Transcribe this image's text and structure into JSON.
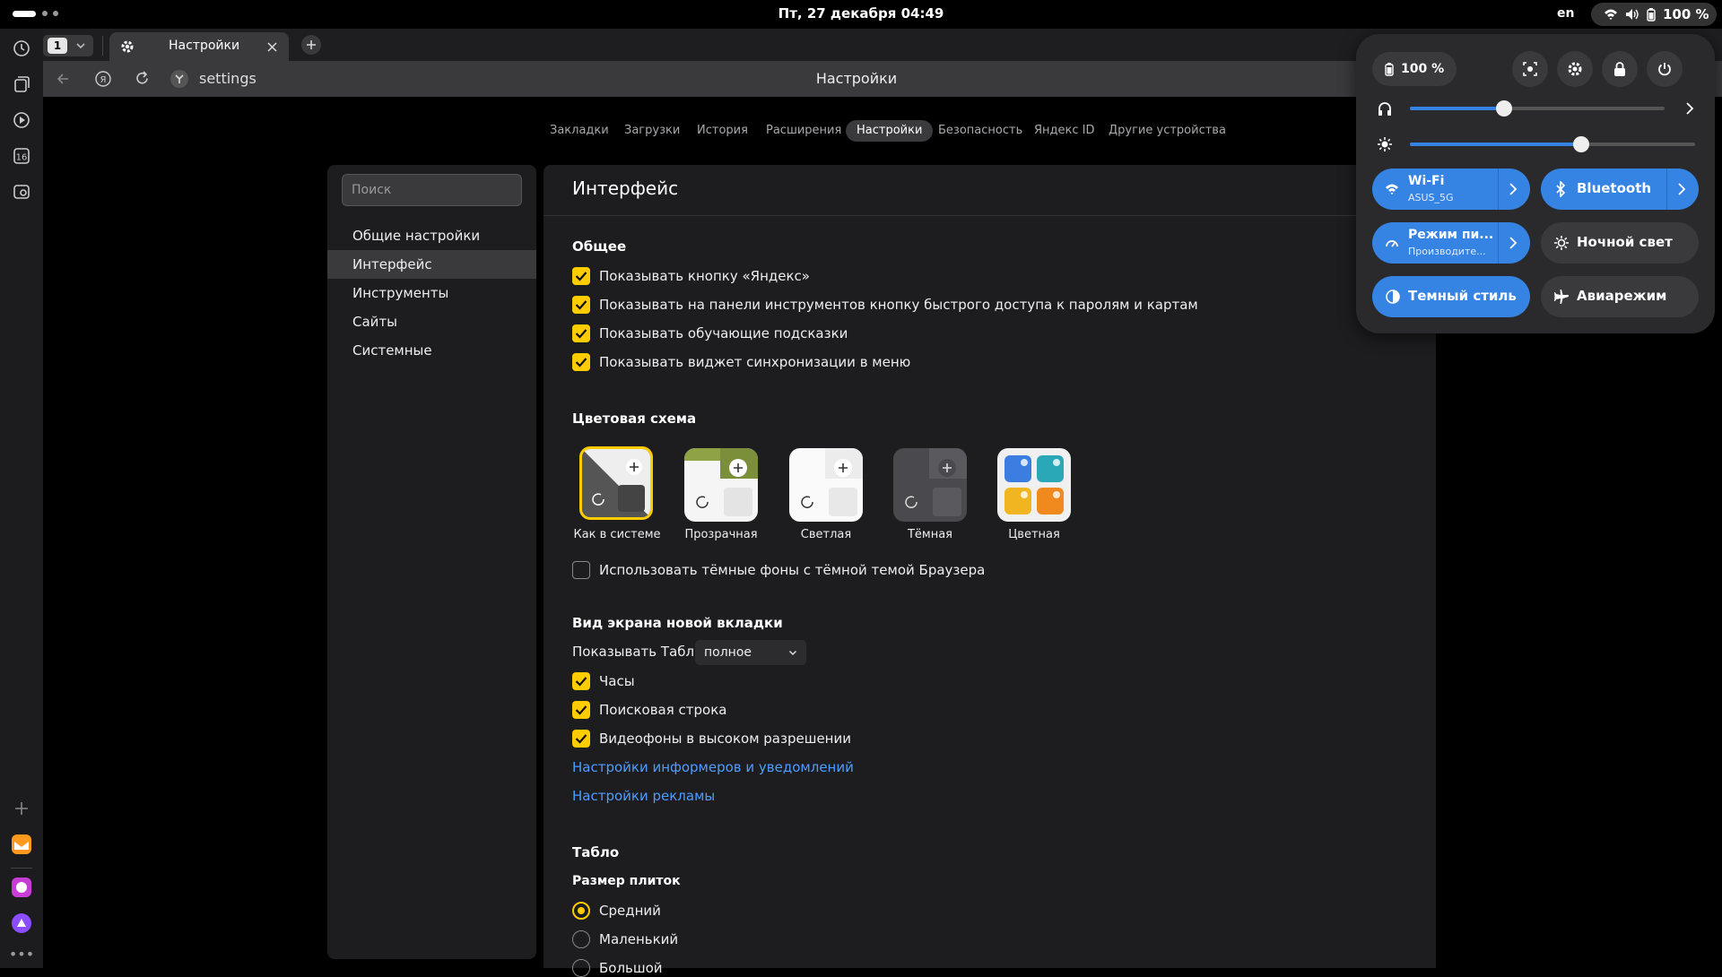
{
  "topbar": {
    "clock": "Пт, 27 декабря  04:49",
    "lang": "en",
    "battery": "100 %"
  },
  "tabs": {
    "count": "1",
    "title": "Настройки"
  },
  "navbar": {
    "address": "settings",
    "page_title": "Настройки"
  },
  "topnav": [
    "Закладки",
    "Загрузки",
    "История",
    "Расширения",
    "Настройки",
    "Безопасность",
    "Яндекс ID",
    "Другие устройства"
  ],
  "sidebar": {
    "search_placeholder": "Поиск",
    "items": [
      "Общие настройки",
      "Интерфейс",
      "Инструменты",
      "Сайты",
      "Системные"
    ]
  },
  "panel": {
    "title": "Интерфейс",
    "general": {
      "heading": "Общее",
      "options": [
        "Показывать кнопку «Яндекс»",
        "Показывать на панели инструментов кнопку быстрого доступа к паролям и картам",
        "Показывать обучающие подсказки",
        "Показывать виджет синхронизации в меню"
      ]
    },
    "colors": {
      "heading": "Цветовая схема",
      "themes": [
        "Как в системе",
        "Прозрачная",
        "Светлая",
        "Тёмная",
        "Цветная"
      ],
      "dark_bg_option": "Использовать тёмные фоны с тёмной темой Браузера"
    },
    "newtab": {
      "heading": "Вид экрана новой вкладки",
      "tablo_label": "Показывать Табло",
      "tablo_value": "полное",
      "options": [
        "Часы",
        "Поисковая строка",
        "Видеофоны в высоком разрешении"
      ],
      "link_informers": "Настройки информеров и уведомлений",
      "link_ads": "Настройки рекламы"
    },
    "tablo": {
      "heading": "Табло",
      "size_heading": "Размер плиток",
      "sizes": [
        "Средний",
        "Маленький",
        "Большой"
      ]
    }
  },
  "quick_settings": {
    "battery": "100 %",
    "wifi": {
      "label": "Wi-Fi",
      "sub": "ASUS_5G"
    },
    "bluetooth": "Bluetooth",
    "power_mode": {
      "label": "Режим пи...",
      "sub": "Производите..."
    },
    "night_light": "Ночной свет",
    "dark_style": "Темный стиль",
    "airplane": "Авиарежим",
    "volume": 0.37,
    "brightness": 0.6
  },
  "colors": {
    "accent": "#ffcc00",
    "link": "#4e9cff",
    "qs_blue": "#3584e4"
  }
}
